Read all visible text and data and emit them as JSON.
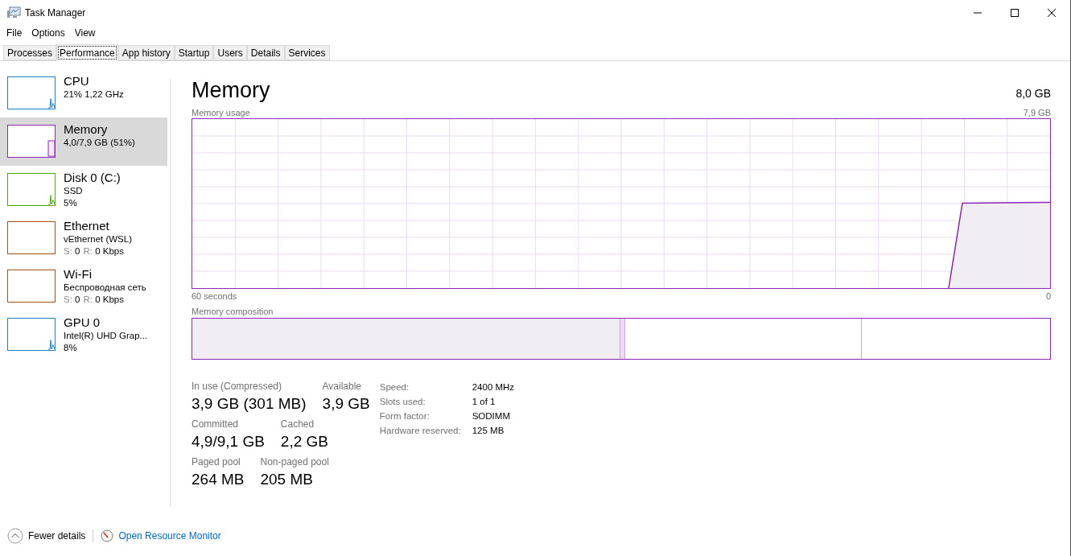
{
  "window": {
    "title": "Task Manager"
  },
  "menu": [
    "File",
    "Options",
    "View"
  ],
  "tabs": [
    {
      "label": "Processes",
      "selected": false
    },
    {
      "label": "Performance",
      "selected": true
    },
    {
      "label": "App history",
      "selected": false
    },
    {
      "label": "Startup",
      "selected": false
    },
    {
      "label": "Users",
      "selected": false
    },
    {
      "label": "Details",
      "selected": false
    },
    {
      "label": "Services",
      "selected": false
    }
  ],
  "sidebar": {
    "items": [
      {
        "name": "CPU",
        "lines": [
          "21% 1,22 GHz"
        ],
        "color": "#1f7fc4",
        "kind": "spike",
        "selected": false
      },
      {
        "name": "Memory",
        "lines": [
          "4,0/7,9 GB (51%)"
        ],
        "color": "#8b26b5",
        "kind": "step",
        "selected": true
      },
      {
        "name": "Disk 0 (C:)",
        "lines": [
          "SSD",
          "5%"
        ],
        "color": "#4da60c",
        "kind": "spike",
        "selected": false
      },
      {
        "name": "Ethernet",
        "lines": [
          "vEthernet (WSL)"
        ],
        "stats": [
          {
            "key": "S:",
            "value": "0"
          },
          {
            "key": "R:",
            "value": "0 Kbps"
          }
        ],
        "color": "#a7500f",
        "kind": "flat",
        "selected": false
      },
      {
        "name": "Wi-Fi",
        "lines": [
          "Беспроводная сеть"
        ],
        "stats": [
          {
            "key": "S:",
            "value": "0"
          },
          {
            "key": "R:",
            "value": "0 Kbps"
          }
        ],
        "color": "#a7500f",
        "kind": "flat",
        "selected": false
      },
      {
        "name": "GPU 0",
        "lines": [
          "Intel(R) UHD Grap...",
          "8%"
        ],
        "color": "#1f7fc4",
        "kind": "spike",
        "selected": false
      }
    ]
  },
  "main": {
    "title": "Memory",
    "total": "8,0 GB",
    "usage_label": "Memory usage",
    "usage_max": "7,9 GB",
    "time_label": "60 seconds",
    "usage_min": "0",
    "composition_label": "Memory composition",
    "stats": [
      [
        {
          "label": "In use (Compressed)",
          "value": "3,9 GB (301 MB)"
        },
        {
          "label": "Available",
          "value": "3,9 GB"
        }
      ],
      [
        {
          "label": "Committed",
          "value": "4,9/9,1 GB"
        },
        {
          "label": "Cached",
          "value": "2,2 GB"
        }
      ],
      [
        {
          "label": "Paged pool",
          "value": "264 MB"
        },
        {
          "label": "Non-paged pool",
          "value": "205 MB"
        }
      ]
    ],
    "details": [
      {
        "label": "Speed:",
        "value": "2400 MHz"
      },
      {
        "label": "Slots used:",
        "value": "1 of 1"
      },
      {
        "label": "Form factor:",
        "value": "SODIMM"
      },
      {
        "label": "Hardware reserved:",
        "value": "125 MB"
      }
    ]
  },
  "footer": {
    "fewer_details": "Fewer details",
    "resource_monitor": "Open Resource Monitor"
  }
}
